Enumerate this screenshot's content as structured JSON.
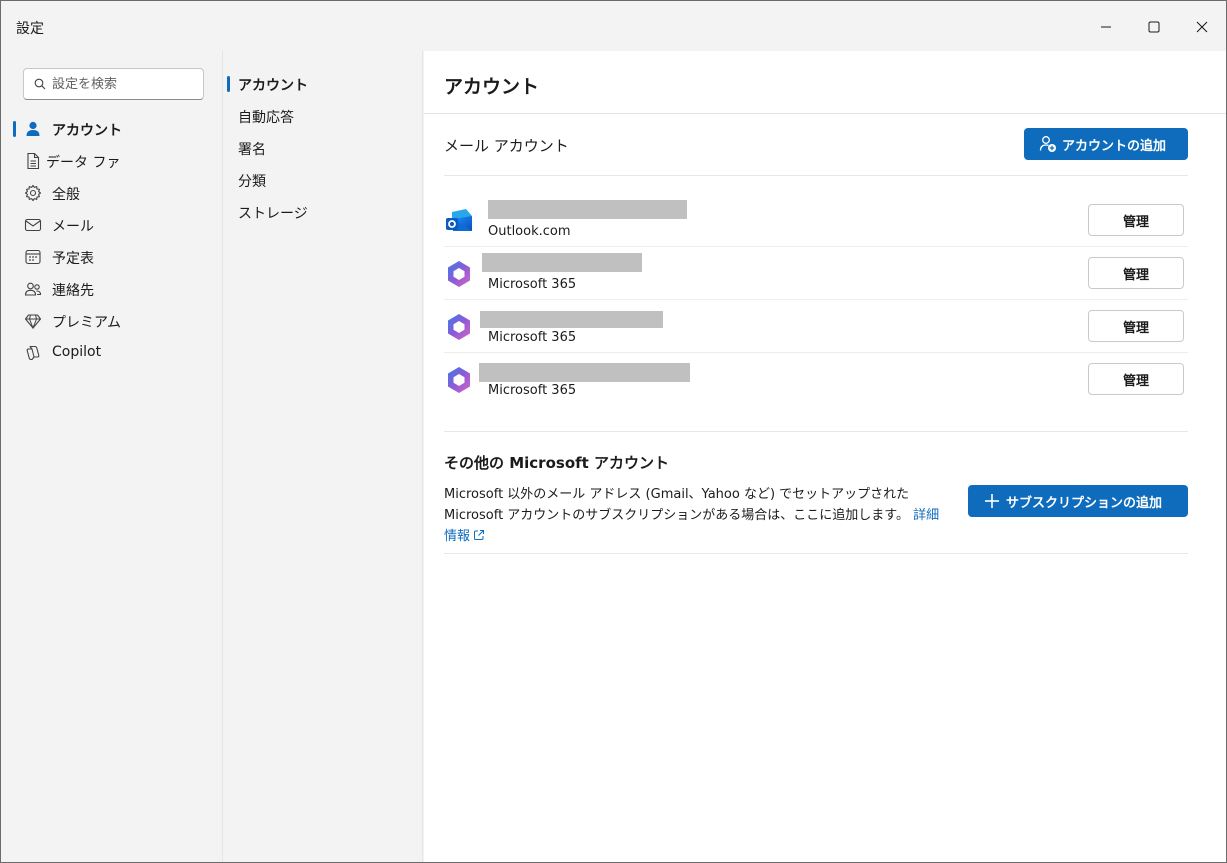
{
  "window": {
    "title": "設定"
  },
  "search": {
    "placeholder": "設定を検索"
  },
  "leftnav": {
    "items": [
      {
        "label": "アカウント",
        "icon": "person-icon",
        "active": true
      },
      {
        "label": "データ ファ",
        "icon": "document-icon",
        "active": false
      },
      {
        "label": "全般",
        "icon": "gear-icon",
        "active": false
      },
      {
        "label": "メール",
        "icon": "mail-icon",
        "active": false
      },
      {
        "label": "予定表",
        "icon": "calendar-icon",
        "active": false
      },
      {
        "label": "連絡先",
        "icon": "people-icon",
        "active": false
      },
      {
        "label": "プレミアム",
        "icon": "diamond-icon",
        "active": false
      },
      {
        "label": "Copilot",
        "icon": "copilot-icon",
        "active": false
      }
    ]
  },
  "subnav": {
    "items": [
      {
        "label": "アカウント",
        "active": true
      },
      {
        "label": "自動応答",
        "active": false
      },
      {
        "label": "署名",
        "active": false
      },
      {
        "label": "分類",
        "active": false
      },
      {
        "label": "ストレージ",
        "active": false
      }
    ]
  },
  "main": {
    "title": "アカウント",
    "mail_accounts": {
      "heading": "メール アカウント",
      "add_button": "アカウントの追加",
      "accounts": [
        {
          "type": "Outlook.com",
          "icon": "outlook-icon",
          "manage": "管理"
        },
        {
          "type": "Microsoft 365",
          "icon": "microsoft365-icon",
          "manage": "管理"
        },
        {
          "type": "Microsoft 365",
          "icon": "microsoft365-icon",
          "manage": "管理"
        },
        {
          "type": "Microsoft 365",
          "icon": "microsoft365-icon",
          "manage": "管理"
        }
      ]
    },
    "other_accounts": {
      "heading": "その他の Microsoft アカウント",
      "description": "Microsoft 以外のメール アドレス (Gmail、Yahoo など) でセットアップされた Microsoft アカウントのサブスクリプションがある場合は、ここに追加します。",
      "link": "詳細情報",
      "add_button": "サブスクリプションの追加"
    }
  },
  "colors": {
    "accent": "#0f6cbd",
    "sidebar_bg": "#f3f3f3",
    "content_bg": "#ffffff",
    "redaction": "#c0c0c0"
  }
}
